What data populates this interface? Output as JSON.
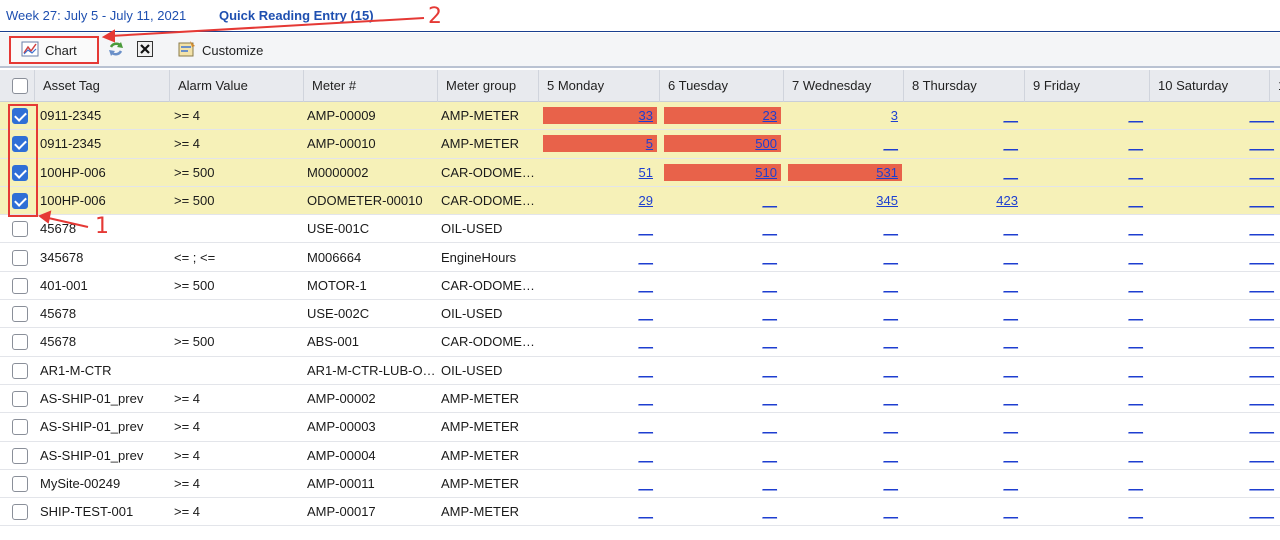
{
  "header": {
    "week_label": "Week 27: July 5 - July 11, 2021",
    "quick_entry_link": "Quick Reading Entry (15)"
  },
  "toolbar": {
    "chart_label": "Chart",
    "chart_icon": "chart-icon",
    "refresh_icon": "refresh-icon",
    "cancel_icon": "close-box-icon",
    "customize_label": "Customize",
    "customize_icon": "customize-icon"
  },
  "columns": [
    "Asset Tag",
    "Alarm Value",
    "Meter #",
    "Meter group",
    "5  Monday",
    "6  Tuesday",
    "7  Wednesday",
    "8  Thursday",
    "9  Friday",
    "10  Saturday",
    "1"
  ],
  "rows": [
    {
      "checked": true,
      "asset": "0911-2345",
      "alarm": ">= 4",
      "meter": "AMP-00009",
      "group": "AMP-METER",
      "days": [
        "33",
        "23",
        "3",
        "__",
        "__",
        "__"
      ],
      "alarm_hit": [
        true,
        true,
        false,
        false,
        false,
        false
      ]
    },
    {
      "checked": true,
      "asset": "0911-2345",
      "alarm": ">= 4",
      "meter": "AMP-00010",
      "group": "AMP-METER",
      "days": [
        "5",
        "500",
        "__",
        "__",
        "__",
        "__"
      ],
      "alarm_hit": [
        true,
        true,
        false,
        false,
        false,
        false
      ]
    },
    {
      "checked": true,
      "asset": "100HP-006",
      "alarm": ">= 500",
      "meter": "M0000002",
      "group": "CAR-ODOMETER",
      "days": [
        "51",
        "510",
        "531",
        "__",
        "__",
        "__"
      ],
      "alarm_hit": [
        false,
        true,
        true,
        false,
        false,
        false
      ]
    },
    {
      "checked": true,
      "asset": "100HP-006",
      "alarm": ">= 500",
      "meter": "ODOMETER-00010",
      "group": "CAR-ODOMETER",
      "days": [
        "29",
        "__",
        "345",
        "423",
        "__",
        "__"
      ],
      "alarm_hit": [
        false,
        false,
        false,
        false,
        false,
        false
      ]
    },
    {
      "checked": false,
      "asset": "45678",
      "alarm": "",
      "meter": "USE-001C",
      "group": "OIL-USED",
      "days": [
        "__",
        "__",
        "__",
        "__",
        "__",
        "__"
      ],
      "alarm_hit": [
        false,
        false,
        false,
        false,
        false,
        false
      ]
    },
    {
      "checked": false,
      "asset": "345678",
      "alarm": "<= ; <=",
      "meter": "M006664",
      "group": "EngineHours",
      "days": [
        "__",
        "__",
        "__",
        "__",
        "__",
        "__"
      ],
      "alarm_hit": [
        false,
        false,
        false,
        false,
        false,
        false
      ]
    },
    {
      "checked": false,
      "asset": "401-001",
      "alarm": ">= 500",
      "meter": "MOTOR-1",
      "group": "CAR-ODOMET…",
      "days": [
        "__",
        "__",
        "__",
        "__",
        "__",
        "__"
      ],
      "alarm_hit": [
        false,
        false,
        false,
        false,
        false,
        false
      ]
    },
    {
      "checked": false,
      "asset": "45678",
      "alarm": "",
      "meter": "USE-002C",
      "group": "OIL-USED",
      "days": [
        "__",
        "__",
        "__",
        "__",
        "__",
        "__"
      ],
      "alarm_hit": [
        false,
        false,
        false,
        false,
        false,
        false
      ]
    },
    {
      "checked": false,
      "asset": "45678",
      "alarm": ">= 500",
      "meter": "ABS-001",
      "group": "CAR-ODOMET…",
      "days": [
        "__",
        "__",
        "__",
        "__",
        "__",
        "__"
      ],
      "alarm_hit": [
        false,
        false,
        false,
        false,
        false,
        false
      ]
    },
    {
      "checked": false,
      "asset": "AR1-M-CTR",
      "alarm": "",
      "meter": "AR1-M-CTR-LUB-O…",
      "group": "OIL-USED",
      "days": [
        "__",
        "__",
        "__",
        "__",
        "__",
        "__"
      ],
      "alarm_hit": [
        false,
        false,
        false,
        false,
        false,
        false
      ]
    },
    {
      "checked": false,
      "asset": "AS-SHIP-01_prev",
      "alarm": ">= 4",
      "meter": "AMP-00002",
      "group": "AMP-METER",
      "days": [
        "__",
        "__",
        "__",
        "__",
        "__",
        "__"
      ],
      "alarm_hit": [
        false,
        false,
        false,
        false,
        false,
        false
      ]
    },
    {
      "checked": false,
      "asset": "AS-SHIP-01_prev",
      "alarm": ">= 4",
      "meter": "AMP-00003",
      "group": "AMP-METER",
      "days": [
        "__",
        "__",
        "__",
        "__",
        "__",
        "__"
      ],
      "alarm_hit": [
        false,
        false,
        false,
        false,
        false,
        false
      ]
    },
    {
      "checked": false,
      "asset": "AS-SHIP-01_prev",
      "alarm": ">= 4",
      "meter": "AMP-00004",
      "group": "AMP-METER",
      "days": [
        "__",
        "__",
        "__",
        "__",
        "__",
        "__"
      ],
      "alarm_hit": [
        false,
        false,
        false,
        false,
        false,
        false
      ]
    },
    {
      "checked": false,
      "asset": "MySite-00249",
      "alarm": ">= 4",
      "meter": "AMP-00011",
      "group": "AMP-METER",
      "days": [
        "__",
        "__",
        "__",
        "__",
        "__",
        "__"
      ],
      "alarm_hit": [
        false,
        false,
        false,
        false,
        false,
        false
      ]
    },
    {
      "checked": false,
      "asset": "SHIP-TEST-001",
      "alarm": ">= 4",
      "meter": "AMP-00017",
      "group": "AMP-METER",
      "days": [
        "__",
        "__",
        "__",
        "__",
        "__",
        "__"
      ],
      "alarm_hit": [
        false,
        false,
        false,
        false,
        false,
        false
      ]
    }
  ],
  "annotations": {
    "step1": "1",
    "step2": "2"
  },
  "colors": {
    "alarm_bar": "#e8624a",
    "selected_row": "#f6f1b8",
    "link": "#1e3fd0",
    "annotation": "#e53935"
  }
}
